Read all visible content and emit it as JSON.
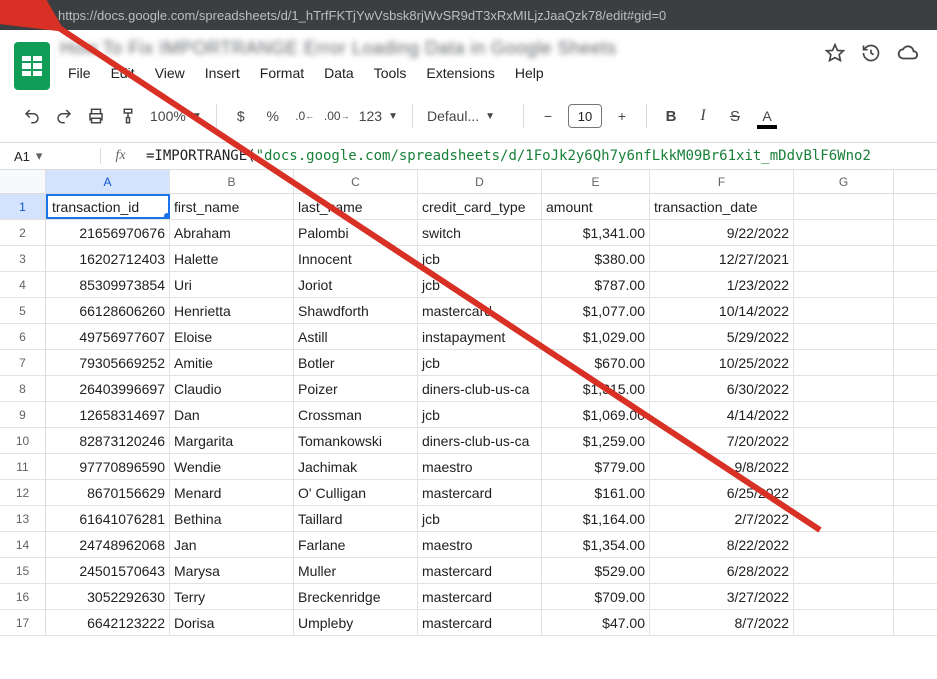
{
  "browser": {
    "url": "https://docs.google.com/spreadsheets/d/1_hTrfFKTjYwVsbsk8rjWvSR9dT3xRxMILjzJaaQzk78/edit#gid=0"
  },
  "doc": {
    "title_blurred": "How To Fix IMPORTRANGE Error Loading Data in Google Sheets"
  },
  "menus": {
    "file": "File",
    "edit": "Edit",
    "view": "View",
    "insert": "Insert",
    "format": "Format",
    "data": "Data",
    "tools": "Tools",
    "extensions": "Extensions",
    "help": "Help"
  },
  "toolbar": {
    "zoom": "100%",
    "currency": "$",
    "percent": "%",
    "dec_less": ".0",
    "dec_more": ".00",
    "num_fmt": "123",
    "font": "Defaul...",
    "font_size": "10",
    "bold": "B",
    "italic": "I",
    "strike": "S",
    "text_color": "A",
    "minus": "−",
    "plus": "+"
  },
  "namebox": "A1",
  "formula": {
    "pre": "=IMPORTRANGE(",
    "lit": "\"docs.google.com/spreadsheets/d/1FoJk2y6Qh7y6nfLkkM09Br61xit_mDdvBlF6Wno2"
  },
  "columns": [
    "A",
    "B",
    "C",
    "D",
    "E",
    "F",
    "G"
  ],
  "headers": {
    "a": "transaction_id",
    "b": "first_name",
    "c": "last_name",
    "d": "credit_card_type",
    "e": "amount",
    "f": "transaction_date"
  },
  "rows": [
    {
      "n": "2",
      "a": "21656970676",
      "b": "Abraham",
      "c": "Palombi",
      "d": "switch",
      "e": "$1,341.00",
      "f": "9/22/2022"
    },
    {
      "n": "3",
      "a": "16202712403",
      "b": "Halette",
      "c": "Innocent",
      "d": "jcb",
      "e": "$380.00",
      "f": "12/27/2021"
    },
    {
      "n": "4",
      "a": "85309973854",
      "b": "Uri",
      "c": "Joriot",
      "d": "jcb",
      "e": "$787.00",
      "f": "1/23/2022"
    },
    {
      "n": "5",
      "a": "66128606260",
      "b": "Henrietta",
      "c": "Shawdforth",
      "d": "mastercard",
      "e": "$1,077.00",
      "f": "10/14/2022"
    },
    {
      "n": "6",
      "a": "49756977607",
      "b": "Eloise",
      "c": "Astill",
      "d": "instapayment",
      "e": "$1,029.00",
      "f": "5/29/2022"
    },
    {
      "n": "7",
      "a": "79305669252",
      "b": "Amitie",
      "c": "Botler",
      "d": "jcb",
      "e": "$670.00",
      "f": "10/25/2022"
    },
    {
      "n": "8",
      "a": "26403996697",
      "b": "Claudio",
      "c": "Poizer",
      "d": "diners-club-us-ca",
      "e": "$1,315.00",
      "f": "6/30/2022"
    },
    {
      "n": "9",
      "a": "12658314697",
      "b": "Dan",
      "c": "Crossman",
      "d": "jcb",
      "e": "$1,069.00",
      "f": "4/14/2022"
    },
    {
      "n": "10",
      "a": "82873120246",
      "b": "Margarita",
      "c": "Tomankowski",
      "d": "diners-club-us-ca",
      "e": "$1,259.00",
      "f": "7/20/2022"
    },
    {
      "n": "11",
      "a": "97770896590",
      "b": "Wendie",
      "c": "Jachimak",
      "d": "maestro",
      "e": "$779.00",
      "f": "9/8/2022"
    },
    {
      "n": "12",
      "a": "8670156629",
      "b": "Menard",
      "c": "O' Culligan",
      "d": "mastercard",
      "e": "$161.00",
      "f": "6/25/2022"
    },
    {
      "n": "13",
      "a": "61641076281",
      "b": "Bethina",
      "c": "Taillard",
      "d": "jcb",
      "e": "$1,164.00",
      "f": "2/7/2022"
    },
    {
      "n": "14",
      "a": "24748962068",
      "b": "Jan",
      "c": "Farlane",
      "d": "maestro",
      "e": "$1,354.00",
      "f": "8/22/2022"
    },
    {
      "n": "15",
      "a": "24501570643",
      "b": "Marysa",
      "c": "Muller",
      "d": "mastercard",
      "e": "$529.00",
      "f": "6/28/2022"
    },
    {
      "n": "16",
      "a": "3052292630",
      "b": "Terry",
      "c": "Breckenridge",
      "d": "mastercard",
      "e": "$709.00",
      "f": "3/27/2022"
    },
    {
      "n": "17",
      "a": "6642123222",
      "b": "Dorisa",
      "c": "Umpleby",
      "d": "mastercard",
      "e": "$47.00",
      "f": "8/7/2022"
    }
  ]
}
